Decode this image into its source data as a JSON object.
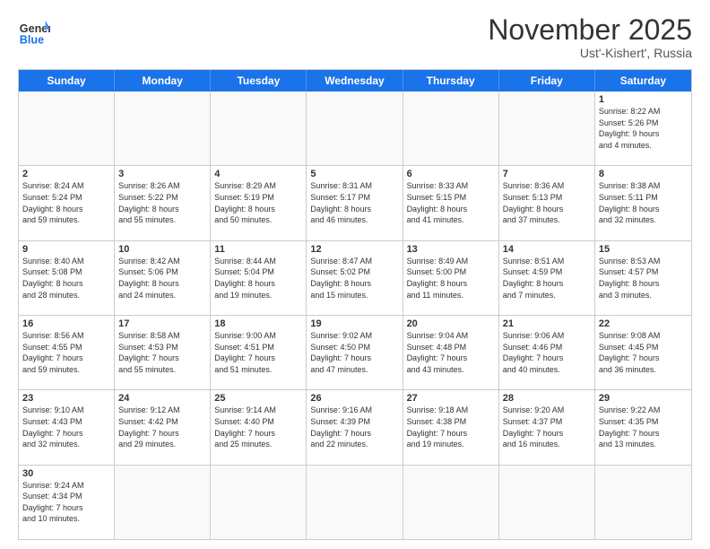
{
  "header": {
    "logo_general": "General",
    "logo_blue": "Blue",
    "month": "November 2025",
    "location": "Ust'-Kishert', Russia"
  },
  "weekdays": [
    "Sunday",
    "Monday",
    "Tuesday",
    "Wednesday",
    "Thursday",
    "Friday",
    "Saturday"
  ],
  "weeks": [
    [
      {
        "day": "",
        "info": ""
      },
      {
        "day": "",
        "info": ""
      },
      {
        "day": "",
        "info": ""
      },
      {
        "day": "",
        "info": ""
      },
      {
        "day": "",
        "info": ""
      },
      {
        "day": "",
        "info": ""
      },
      {
        "day": "1",
        "info": "Sunrise: 8:22 AM\nSunset: 5:26 PM\nDaylight: 9 hours\nand 4 minutes."
      }
    ],
    [
      {
        "day": "2",
        "info": "Sunrise: 8:24 AM\nSunset: 5:24 PM\nDaylight: 8 hours\nand 59 minutes."
      },
      {
        "day": "3",
        "info": "Sunrise: 8:26 AM\nSunset: 5:22 PM\nDaylight: 8 hours\nand 55 minutes."
      },
      {
        "day": "4",
        "info": "Sunrise: 8:29 AM\nSunset: 5:19 PM\nDaylight: 8 hours\nand 50 minutes."
      },
      {
        "day": "5",
        "info": "Sunrise: 8:31 AM\nSunset: 5:17 PM\nDaylight: 8 hours\nand 46 minutes."
      },
      {
        "day": "6",
        "info": "Sunrise: 8:33 AM\nSunset: 5:15 PM\nDaylight: 8 hours\nand 41 minutes."
      },
      {
        "day": "7",
        "info": "Sunrise: 8:36 AM\nSunset: 5:13 PM\nDaylight: 8 hours\nand 37 minutes."
      },
      {
        "day": "8",
        "info": "Sunrise: 8:38 AM\nSunset: 5:11 PM\nDaylight: 8 hours\nand 32 minutes."
      }
    ],
    [
      {
        "day": "9",
        "info": "Sunrise: 8:40 AM\nSunset: 5:08 PM\nDaylight: 8 hours\nand 28 minutes."
      },
      {
        "day": "10",
        "info": "Sunrise: 8:42 AM\nSunset: 5:06 PM\nDaylight: 8 hours\nand 24 minutes."
      },
      {
        "day": "11",
        "info": "Sunrise: 8:44 AM\nSunset: 5:04 PM\nDaylight: 8 hours\nand 19 minutes."
      },
      {
        "day": "12",
        "info": "Sunrise: 8:47 AM\nSunset: 5:02 PM\nDaylight: 8 hours\nand 15 minutes."
      },
      {
        "day": "13",
        "info": "Sunrise: 8:49 AM\nSunset: 5:00 PM\nDaylight: 8 hours\nand 11 minutes."
      },
      {
        "day": "14",
        "info": "Sunrise: 8:51 AM\nSunset: 4:59 PM\nDaylight: 8 hours\nand 7 minutes."
      },
      {
        "day": "15",
        "info": "Sunrise: 8:53 AM\nSunset: 4:57 PM\nDaylight: 8 hours\nand 3 minutes."
      }
    ],
    [
      {
        "day": "16",
        "info": "Sunrise: 8:56 AM\nSunset: 4:55 PM\nDaylight: 7 hours\nand 59 minutes."
      },
      {
        "day": "17",
        "info": "Sunrise: 8:58 AM\nSunset: 4:53 PM\nDaylight: 7 hours\nand 55 minutes."
      },
      {
        "day": "18",
        "info": "Sunrise: 9:00 AM\nSunset: 4:51 PM\nDaylight: 7 hours\nand 51 minutes."
      },
      {
        "day": "19",
        "info": "Sunrise: 9:02 AM\nSunset: 4:50 PM\nDaylight: 7 hours\nand 47 minutes."
      },
      {
        "day": "20",
        "info": "Sunrise: 9:04 AM\nSunset: 4:48 PM\nDaylight: 7 hours\nand 43 minutes."
      },
      {
        "day": "21",
        "info": "Sunrise: 9:06 AM\nSunset: 4:46 PM\nDaylight: 7 hours\nand 40 minutes."
      },
      {
        "day": "22",
        "info": "Sunrise: 9:08 AM\nSunset: 4:45 PM\nDaylight: 7 hours\nand 36 minutes."
      }
    ],
    [
      {
        "day": "23",
        "info": "Sunrise: 9:10 AM\nSunset: 4:43 PM\nDaylight: 7 hours\nand 32 minutes."
      },
      {
        "day": "24",
        "info": "Sunrise: 9:12 AM\nSunset: 4:42 PM\nDaylight: 7 hours\nand 29 minutes."
      },
      {
        "day": "25",
        "info": "Sunrise: 9:14 AM\nSunset: 4:40 PM\nDaylight: 7 hours\nand 25 minutes."
      },
      {
        "day": "26",
        "info": "Sunrise: 9:16 AM\nSunset: 4:39 PM\nDaylight: 7 hours\nand 22 minutes."
      },
      {
        "day": "27",
        "info": "Sunrise: 9:18 AM\nSunset: 4:38 PM\nDaylight: 7 hours\nand 19 minutes."
      },
      {
        "day": "28",
        "info": "Sunrise: 9:20 AM\nSunset: 4:37 PM\nDaylight: 7 hours\nand 16 minutes."
      },
      {
        "day": "29",
        "info": "Sunrise: 9:22 AM\nSunset: 4:35 PM\nDaylight: 7 hours\nand 13 minutes."
      }
    ],
    [
      {
        "day": "30",
        "info": "Sunrise: 9:24 AM\nSunset: 4:34 PM\nDaylight: 7 hours\nand 10 minutes."
      },
      {
        "day": "",
        "info": ""
      },
      {
        "day": "",
        "info": ""
      },
      {
        "day": "",
        "info": ""
      },
      {
        "day": "",
        "info": ""
      },
      {
        "day": "",
        "info": ""
      },
      {
        "day": "",
        "info": ""
      }
    ]
  ]
}
